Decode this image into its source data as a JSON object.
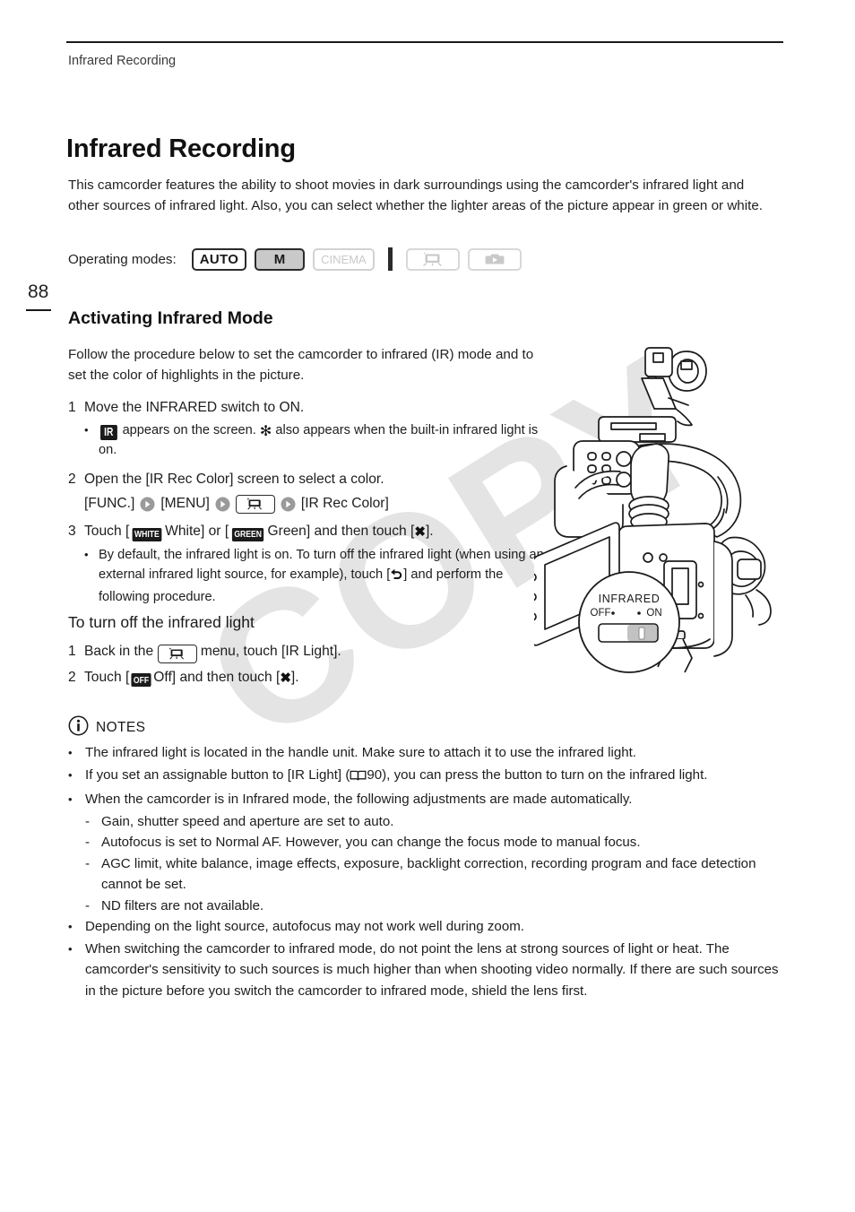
{
  "header": {
    "running_head": "Infrared Recording"
  },
  "page_number": "88",
  "doc": {
    "title": "Infrared Recording",
    "intro": "This camcorder features the ability to shoot movies in dark surroundings using the camcorder's infrared light and other sources of infrared light. Also, you can select whether the lighter areas of the picture appear in green or white."
  },
  "operating_modes": {
    "label": "Operating modes:",
    "badges": [
      {
        "text": "AUTO",
        "state": "active"
      },
      {
        "text": "M",
        "state": "selected"
      },
      {
        "text": "CINEMA",
        "state": "disabled"
      },
      {
        "text": "",
        "state": "disabled",
        "icon": "movie-camera-icon"
      },
      {
        "text": "",
        "state": "disabled",
        "icon": "photo-camera-icon"
      }
    ]
  },
  "section": {
    "title": "Activating Infrared Mode",
    "intro": "Follow the procedure below to set the camcorder to infrared (IR) mode and to set the color of highlights in the picture.",
    "steps": [
      {
        "num": "1",
        "text": "Move the INFRARED switch to ON.",
        "bullets": [
          {
            "pre": "",
            "chip": "IR",
            "mid": "appears on the screen.",
            "sun": "✻",
            "post": "also appears when the built-in infrared light is on."
          }
        ]
      },
      {
        "num": "2",
        "text": "Open the [IR Rec Color] screen to select a color.",
        "path": [
          "[FUNC.]",
          "[MENU]",
          "MENU-ICON",
          "[IR Rec Color]"
        ]
      },
      {
        "num": "3",
        "text_parts": {
          "a": "Touch [",
          "chip1": "WHITE",
          "b": "White] or [",
          "chip2": "GREEN",
          "c": "Green] and then touch [",
          "x": "✖",
          "d": "]."
        },
        "bullets": [
          {
            "a": "By default, the infrared light is on. To turn off the infrared light (when using an external infrared light source, for example), touch [",
            "back": "back-arrow-icon",
            "b": "] and perform the following procedure."
          }
        ]
      }
    ]
  },
  "subsection": {
    "title": "To turn off the infrared light",
    "steps": [
      {
        "num": "1",
        "a": "Back in the",
        "icon": "menu-icon",
        "b": "menu, touch [IR Light]."
      },
      {
        "num": "2",
        "a": "Touch [",
        "chip": "OFF",
        "b": "Off] and then touch [",
        "x": "✖",
        "c": "]."
      }
    ]
  },
  "notes": {
    "icon": "info-icon",
    "title": "NOTES",
    "items": [
      {
        "type": "bullet",
        "text": "The infrared light is located in the handle unit. Make sure to attach it to use the infrared light."
      },
      {
        "type": "bullet-ref",
        "a": "If you set an assignable button to [IR Light] (",
        "ref_icon": "book-icon",
        "ref": "90",
        "b": "), you can press the button to turn on the infrared light."
      },
      {
        "type": "bullet",
        "text": "When the camcorder is in Infrared mode, the following adjustments are made automatically.",
        "sub": [
          "Gain, shutter speed and aperture are set to auto.",
          "Autofocus is set to Normal AF. However, you can change the focus mode to manual focus.",
          "AGC limit, white balance, image effects, exposure, backlight correction, recording program and face detection cannot be set.",
          "ND filters are not available."
        ]
      },
      {
        "type": "bullet",
        "text": "Depending on the light source, autofocus may not work well during zoom."
      },
      {
        "type": "bullet",
        "text": "When switching the camcorder to infrared mode, do not point the lens at strong sources of light or heat. The camcorder's sensitivity to such sources is much higher than when shooting video normally. If there are such sources in the picture before you switch the camcorder to infrared mode, shield the lens first."
      }
    ]
  },
  "illustration": {
    "callout": {
      "title": "INFRARED",
      "off_label": "OFF",
      "on_label": "ON",
      "switch_position": "ON"
    }
  },
  "watermark": {
    "text": "COPY",
    "color": "#e4e4e4"
  }
}
